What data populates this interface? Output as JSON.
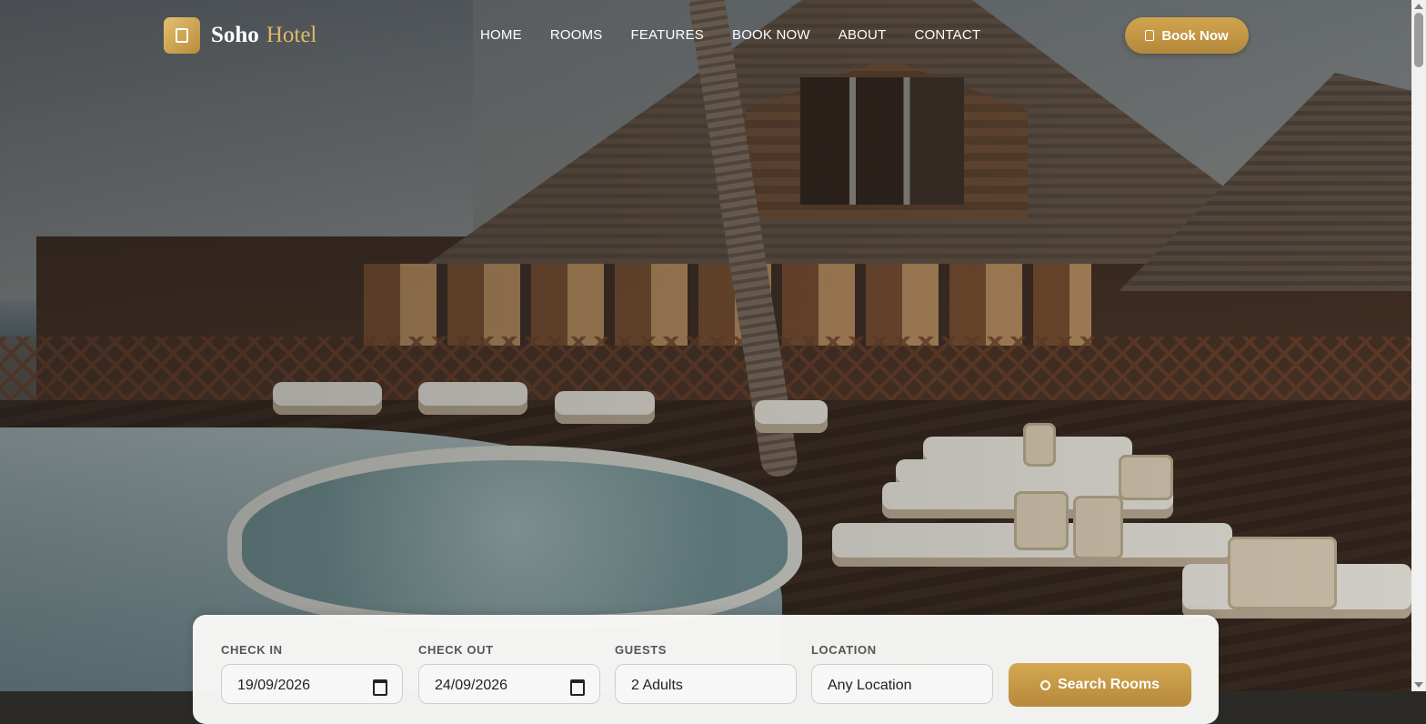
{
  "brand": {
    "name_primary": "Soho",
    "name_secondary": "Hotel",
    "logo_icon": "hotel-icon"
  },
  "nav": {
    "items": [
      {
        "label": "HOME"
      },
      {
        "label": "ROOMS"
      },
      {
        "label": "FEATURES"
      },
      {
        "label": "BOOK NOW"
      },
      {
        "label": "ABOUT"
      },
      {
        "label": "CONTACT"
      }
    ],
    "cta_label": "Book Now",
    "cta_icon": "calendar-icon"
  },
  "booking": {
    "check_in": {
      "label": "CHECK IN",
      "value": "19/09/2026"
    },
    "check_out": {
      "label": "CHECK OUT",
      "value": "24/09/2026"
    },
    "guests": {
      "label": "GUESTS",
      "value": "2 Adults"
    },
    "location": {
      "label": "LOCATION",
      "value": "Any Location"
    },
    "search_label": "Search Rooms",
    "search_icon": "search-icon"
  },
  "colors": {
    "accent": "#c39543",
    "accent_light": "#e0b868",
    "card_bg": "#f8f8f6"
  }
}
